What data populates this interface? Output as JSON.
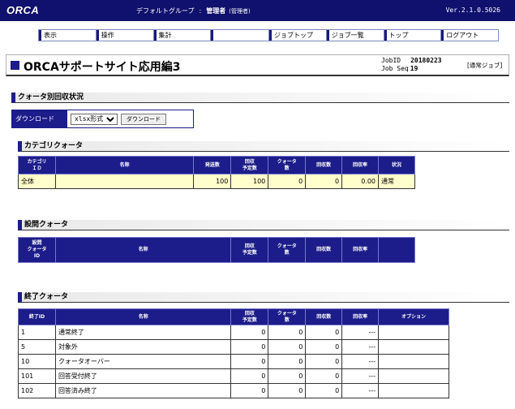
{
  "header": {
    "logo": "ORCA",
    "group": "デフォルトグループ",
    "separator": ":",
    "user": "管理者",
    "role": "(管理者)",
    "version": "Ver.2.1.0.5026"
  },
  "nav": [
    {
      "key": "view",
      "label": "表示"
    },
    {
      "key": "operation",
      "label": "操作"
    },
    {
      "key": "aggregate",
      "label": "集計"
    },
    {
      "key": "blank",
      "label": ""
    },
    {
      "key": "job-top",
      "label": "ジョブトップ"
    },
    {
      "key": "job-list",
      "label": "ジョブ一覧"
    },
    {
      "key": "top",
      "label": "トップ"
    },
    {
      "key": "logout",
      "label": "ログアウト"
    }
  ],
  "page": {
    "title": "ORCAサポートサイト応用編3",
    "job_id_label": "JobID",
    "job_id": "20180223",
    "job_seq_label": "Job Seq",
    "job_seq": "19",
    "job_type": "[通常ジョブ]"
  },
  "quota_section": {
    "title": "クォータ別回収状況",
    "download_label": "ダウンロード",
    "format_value": "xlsx形式",
    "download_button": "ダウンロード"
  },
  "category_quota": {
    "title": "カテゴリクォータ",
    "headers": [
      "カテゴリID",
      "名称",
      "発送数",
      "回収予定数",
      "クォータ数",
      "回収数",
      "回収率",
      "状況"
    ],
    "rows": [
      {
        "id": "全体",
        "name": "",
        "sent": "100",
        "expected": "100",
        "quota": "0",
        "collected": "0",
        "rate": "0.00",
        "status": "通常"
      }
    ]
  },
  "question_quota": {
    "title": "設問クォータ",
    "headers": [
      "設問クォータID",
      "名称",
      "回収予定数",
      "クォータ数",
      "回収数",
      "回収率",
      ""
    ]
  },
  "end_quota": {
    "title": "終了クォータ",
    "headers": [
      "終了ID",
      "名称",
      "回収予定数",
      "クォータ数",
      "回収数",
      "回収率",
      "オプション"
    ],
    "rows": [
      {
        "id": "1",
        "name": "通常終了",
        "expected": "0",
        "quota": "0",
        "collected": "0",
        "rate": "---",
        "option": ""
      },
      {
        "id": "5",
        "name": "対象外",
        "expected": "0",
        "quota": "0",
        "collected": "0",
        "rate": "---",
        "option": ""
      },
      {
        "id": "10",
        "name": "クォータオーバー",
        "expected": "0",
        "quota": "0",
        "collected": "0",
        "rate": "---",
        "option": ""
      },
      {
        "id": "101",
        "name": "回答受付終了",
        "expected": "0",
        "quota": "0",
        "collected": "0",
        "rate": "---",
        "option": ""
      },
      {
        "id": "102",
        "name": "回答済み終了",
        "expected": "0",
        "quota": "0",
        "collected": "0",
        "rate": "---",
        "option": ""
      }
    ]
  }
}
